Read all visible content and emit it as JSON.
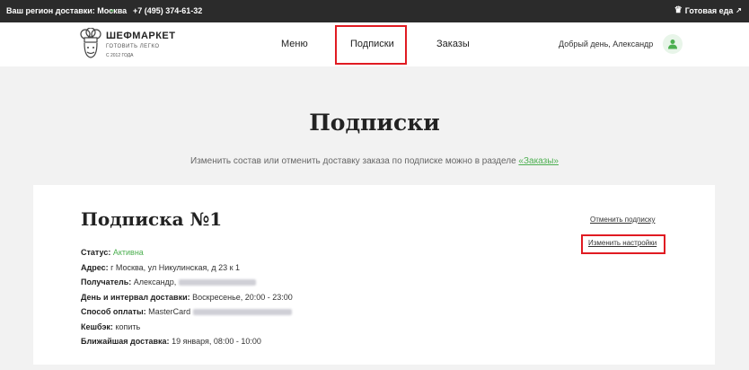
{
  "topbar": {
    "region": "Ваш регион доставки: Москва",
    "phone": "+7 (495) 374-61-32",
    "ready_food": "Готовая еда"
  },
  "header": {
    "logo": {
      "brand": "ШЕФМАРКЕТ",
      "slogan": "ГОТОВИТЬ ЛЕГКО",
      "since": "С 2012 ГОДА"
    },
    "nav": [
      "Меню",
      "Подписки",
      "Заказы"
    ],
    "greeting": "Добрый день, Александр"
  },
  "page": {
    "title": "Подписки",
    "subtitle_prefix": "Изменить состав или отменить доставку заказа по подписке можно в разделе",
    "subtitle_link": "«Заказы»"
  },
  "subscription": {
    "title": "Подписка №1",
    "status_label": "Статус:",
    "status_value": "Активна",
    "address_label": "Адрес:",
    "address_value": "г Москва, ул Никулинская, д 23 к 1",
    "recipient_label": "Получатель:",
    "recipient_value": "Александр,",
    "interval_label": "День и интервал доставки:",
    "interval_value": "Воскресенье, 20:00 - 23:00",
    "payment_label": "Способ оплаты:",
    "payment_value": "MasterCard",
    "cashback_label": "Кешбэк:",
    "cashback_value": "копить",
    "next_label": "Ближайшая доставка:",
    "next_value": "19 января, 08:00 - 10:00",
    "cancel_link": "Отменить подписку",
    "settings_link": "Изменить настройки"
  },
  "colors": {
    "accent": "#4caf50",
    "highlight": "#e01b22",
    "topbar": "#2b2b2b"
  }
}
